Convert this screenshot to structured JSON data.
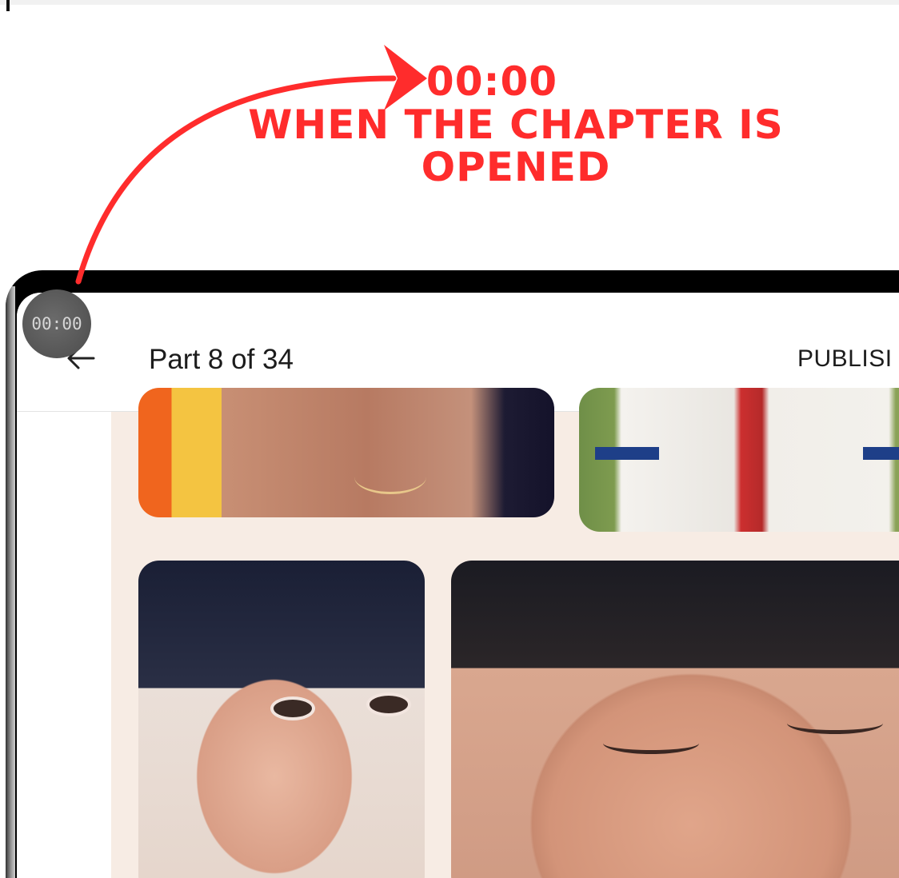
{
  "annotation": {
    "time": "00:00",
    "line1": "WHEN THE CHAPTER IS",
    "line2": "OPENED",
    "color": "#ff2c2c"
  },
  "timer_badge": {
    "value": "00:00"
  },
  "header": {
    "back_icon": "arrow-left-icon",
    "title": "Part 8 of 34",
    "publish_label": "PUBLISI"
  }
}
